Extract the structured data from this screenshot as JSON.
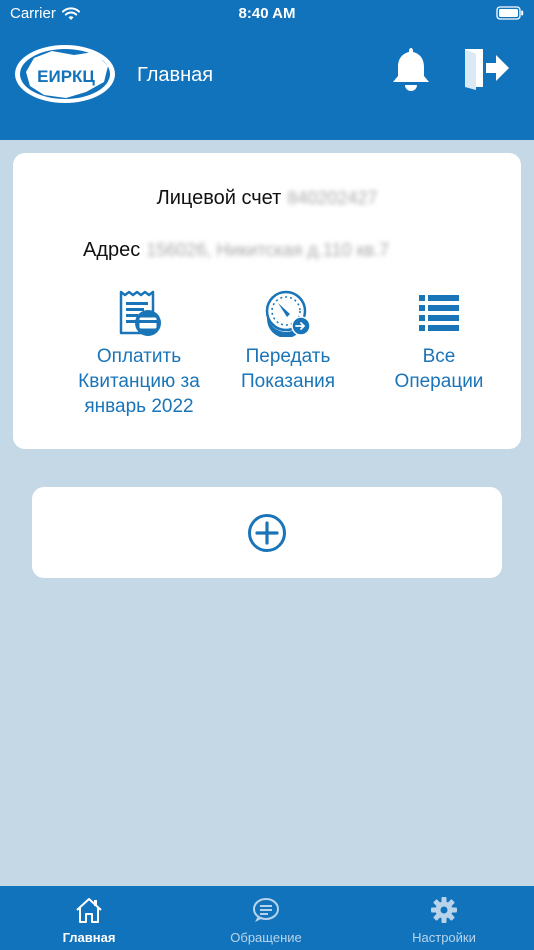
{
  "status_bar": {
    "carrier": "Carrier",
    "time": "8:40 AM"
  },
  "header": {
    "logo_text": "ЕИРКЦ",
    "title": "Главная"
  },
  "account": {
    "account_label": "Лицевой счет",
    "account_number": "840202427",
    "address_label": "Адрес",
    "address_value": "156026, Никитская д.110 кв.7"
  },
  "actions": [
    {
      "label": "Оплатить\nКвитанцию за\nянварь 2022",
      "icon": "receipt-card-icon"
    },
    {
      "label": "Передать\nПоказания",
      "icon": "meter-gauge-icon"
    },
    {
      "label": "Все\nОперации",
      "icon": "list-icon"
    }
  ],
  "add_account": {
    "icon": "plus-circle-icon"
  },
  "tabbar": {
    "items": [
      {
        "label": "Главная",
        "icon": "home-icon",
        "active": true
      },
      {
        "label": "Обращение",
        "icon": "chat-icon",
        "active": false
      },
      {
        "label": "Настройки",
        "icon": "gear-icon",
        "active": false
      }
    ]
  },
  "colors": {
    "brand_blue": "#1273bd",
    "background": "#c5d8e6",
    "link_blue": "#1a74b8",
    "tab_inactive": "#b9d4ea"
  }
}
